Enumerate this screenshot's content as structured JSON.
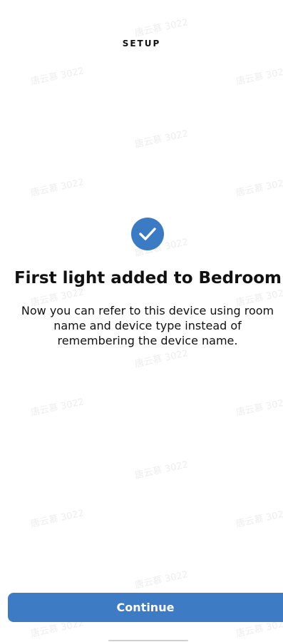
{
  "header": {
    "title": "SETUP"
  },
  "confirmation": {
    "icon": "check-circle-icon",
    "headline": "First light added to Bedroom",
    "description": "Now you can refer to this device using room name and device type instead of remembering the device name."
  },
  "actions": {
    "continue_label": "Continue"
  },
  "watermark": {
    "text": "唐云慕 3022"
  },
  "colors": {
    "accent": "#3d7bc4",
    "text": "#111111",
    "background": "#ffffff"
  }
}
